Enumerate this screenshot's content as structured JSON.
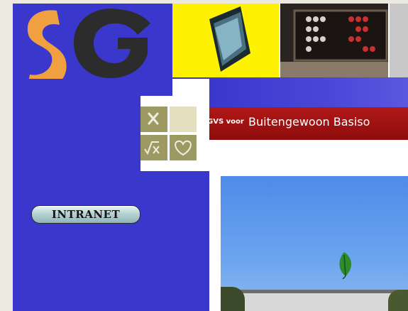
{
  "header": {
    "logo_text": "SG",
    "photos": [
      "book-photo",
      "abacus-photo",
      "laptop-photo"
    ]
  },
  "banner": {
    "prefix": "GVS voor",
    "title": "Buitengewoon Basiso"
  },
  "sidebar": {
    "intranet_label": "INTRANET"
  },
  "icons": [
    "cross-icon",
    "blank-tile",
    "math-icon",
    "heart-icon"
  ],
  "colors": {
    "sidebar_blue": "#3a38cc",
    "banner_red": "#a01212",
    "logo_orange": "#f0a040",
    "logo_dark": "#2a2a2a",
    "book_yellow": "#fff200"
  }
}
